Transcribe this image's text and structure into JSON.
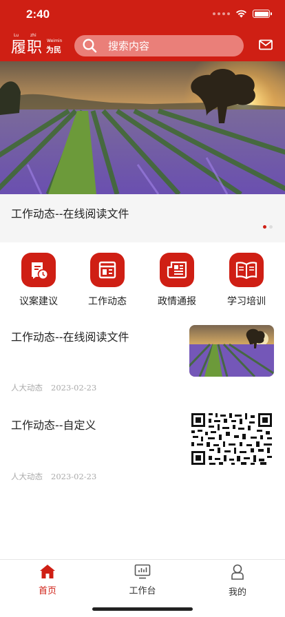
{
  "status": {
    "time": "2:40"
  },
  "logo": {
    "main": "履职",
    "sub": "为民",
    "pinyin1": "Lu",
    "pinyin2": "zhi",
    "pinyin3": "Weimin"
  },
  "search": {
    "placeholder": "搜索内容",
    "icon": "search-icon"
  },
  "header": {
    "mail_icon": "mail-icon"
  },
  "banner": {
    "caption": "工作动态--在线阅读文件",
    "pages": 2,
    "active_page": 1
  },
  "shortcuts": [
    {
      "label": "议案建议",
      "icon": "proposal-icon"
    },
    {
      "label": "工作动态",
      "icon": "work-news-icon"
    },
    {
      "label": "政情通报",
      "icon": "bulletin-icon"
    },
    {
      "label": "学习培训",
      "icon": "book-icon"
    }
  ],
  "news": [
    {
      "title": "工作动态--在线阅读文件",
      "source": "人大动态",
      "date": "2023-02-23",
      "thumb": "landscape"
    },
    {
      "title": "工作动态--自定义",
      "source": "人大动态",
      "date": "2023-02-23",
      "thumb": "qr-code"
    }
  ],
  "tabs": [
    {
      "label": "首页",
      "icon": "home-icon",
      "active": true
    },
    {
      "label": "工作台",
      "icon": "dashboard-icon",
      "active": false
    },
    {
      "label": "我的",
      "icon": "user-icon",
      "active": false
    }
  ],
  "colors": {
    "brand": "#cf1f14",
    "search_bg": "#ea7f79",
    "meta_text": "#aaaaaa"
  }
}
